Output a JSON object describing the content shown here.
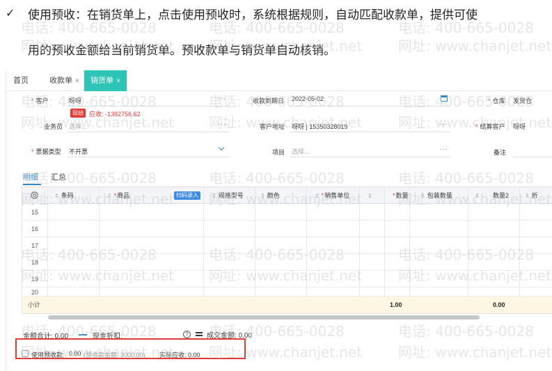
{
  "doc": {
    "check_mark": "✓",
    "line1": "使用预收：在销货单上，点击使用预收时，系统根据规则，自动匹配收款单，提供可使",
    "line2": "用的预收金额给当前销货单。预收款单与销货单自动核销。"
  },
  "watermark": {
    "phone": "电话: 400-665-0028",
    "site": "网址: www.chanjet.net"
  },
  "tabs": [
    {
      "label": "首页"
    },
    {
      "label": "收款单",
      "close": "×"
    },
    {
      "label": "销货单",
      "close": "×"
    }
  ],
  "form": {
    "customer_label": "客户",
    "customer_value": "呀呀",
    "due_date_label": "收款到期日",
    "due_date_value": "2022-05-02",
    "warehouse_label": "仓库",
    "warehouse_value": "发货仓",
    "cash_badge": "现结",
    "receivable_text": "应收: -1382756.62",
    "salesperson_label": "业务员",
    "salesperson_placeholder": "选择...",
    "address_label": "客户地址",
    "address_value": "呀呀 | 15350328019",
    "settle_label": "结算客户",
    "settle_value": "呀呀",
    "invoice_type_label": "票据类型",
    "invoice_type_value": "不开票",
    "project_label": "项目",
    "project_placeholder": "选择...",
    "remark_label": "备注",
    "more_dots": "···"
  },
  "subtabs": [
    {
      "label": "明细"
    },
    {
      "label": "汇总"
    }
  ],
  "grid": {
    "headers": {
      "barcode": "条码",
      "product": "商品",
      "scan_button": "扫码录入",
      "spec": "规格型号",
      "color": "颜色",
      "unit": "销售单位",
      "quantity": "数量",
      "package_qty": "包装数量",
      "quantity2": "数量2",
      "discount": "折"
    },
    "rows": [
      "15",
      "16",
      "17",
      "18",
      "19",
      "20"
    ],
    "total_label": "小计",
    "total_quantity": "1.00",
    "total_quantity2": "0.00"
  },
  "footer": {
    "amount_total": "金额合计: 0.00",
    "cash_discount": "现金折扣:",
    "deal_amount": "成交金额: 0.00",
    "use_advance_label": "使用预收款:",
    "use_advance_value": "0.00",
    "advance_balance": "(预收款金额: 3000.00)",
    "actual_receivable": "实际应收: 0.00",
    "help": "?"
  }
}
